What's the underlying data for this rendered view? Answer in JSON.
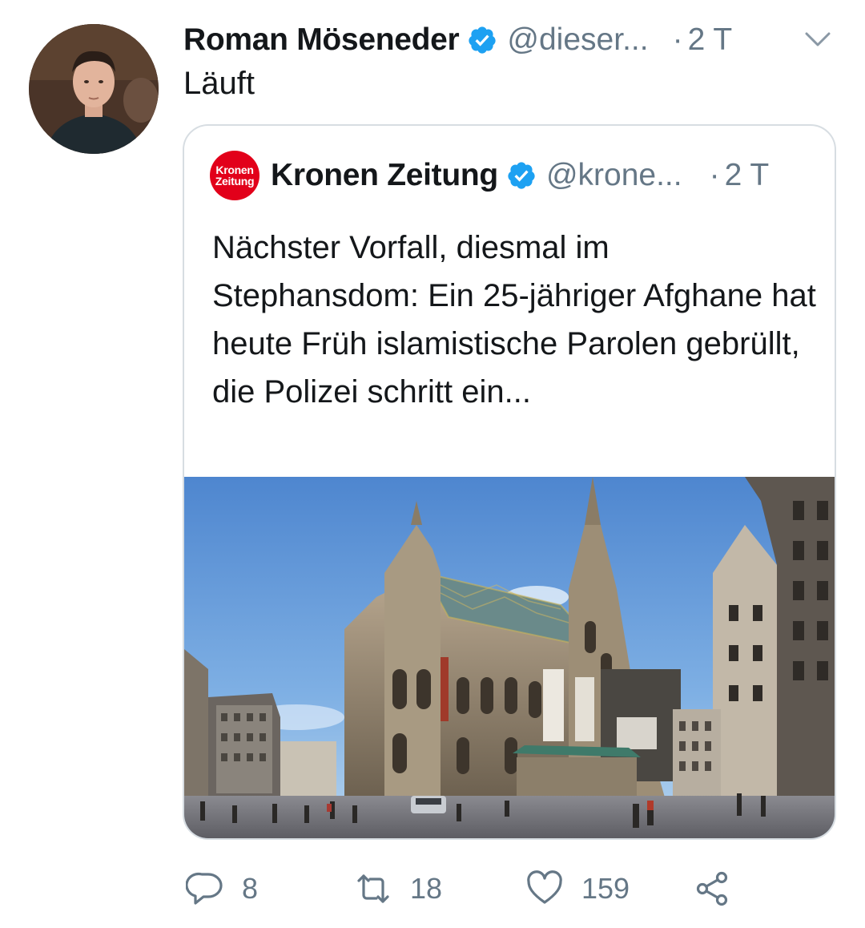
{
  "tweet": {
    "author_name": "Roman Möseneder",
    "author_handle": "@dieser...",
    "time": "2 T",
    "separator": "·",
    "text": "Läuft",
    "avatar_icon": "user-avatar-photo",
    "menu_icon": "chevron-down-icon"
  },
  "quoted_tweet": {
    "logo_lines": [
      "Kronen",
      "Zeitung"
    ],
    "author_name": "Kronen Zeitung",
    "author_handle": "@krone...",
    "time": "2 T",
    "separator": "·",
    "text": "Nächster Vorfall, diesmal im Stephansdom: Ein 25-jähriger Afghane hat heute Früh islamistische Parolen gebrüllt, die Polizei schritt ein...",
    "image": "photo-stephansdom"
  },
  "actions": {
    "reply_count": "8",
    "retweet_count": "18",
    "like_count": "159"
  },
  "colors": {
    "verified_blue": "#1da1f2",
    "muted_text": "#657786",
    "text": "#14171a",
    "border": "#d7dde2",
    "krone_red": "#e2001a"
  }
}
